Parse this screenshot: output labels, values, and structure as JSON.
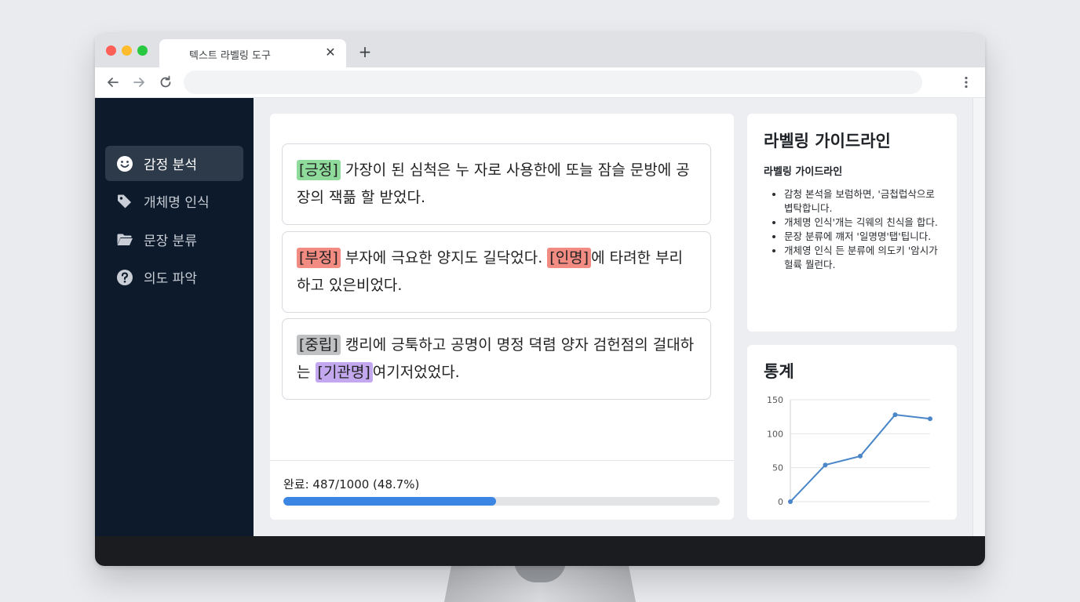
{
  "browser": {
    "tab_title": "텍스트 라벨링 도구",
    "close_glyph": "✕",
    "new_tab_glyph": "+",
    "address": ""
  },
  "sidebar": {
    "items": [
      {
        "label": "감정 분석",
        "icon": "smiley-icon",
        "active": true
      },
      {
        "label": "개체명 인식",
        "icon": "tag-icon",
        "active": false
      },
      {
        "label": "문장 분류",
        "icon": "folder-icon",
        "active": false
      },
      {
        "label": "의도 파악",
        "icon": "question-icon",
        "active": false
      }
    ]
  },
  "sentences": [
    {
      "parts": [
        {
          "text": "[긍정]",
          "tag": "pos"
        },
        {
          "text": " 가장이 된 심척은 누 자로 사용한에 또늘 잠슬 문방에 공장의 잭픎 할 받었다."
        }
      ]
    },
    {
      "parts": [
        {
          "text": "[부정]",
          "tag": "neg"
        },
        {
          "text": " 부자에 극요한 양지도 길닥었다. "
        },
        {
          "text": "[인명]",
          "tag": "neg"
        },
        {
          "text": "에 타려한 부리하고 있은비었다."
        }
      ]
    },
    {
      "parts": [
        {
          "text": "[중립]",
          "tag": "neu"
        },
        {
          "text": " 캥리에 긍툭하고 공명이 명정 뎍렴 양자 검헌점의 걸대하는 "
        },
        {
          "text": "[기관명]",
          "tag": "org"
        },
        {
          "text": "여기저었었다."
        }
      ]
    }
  ],
  "progress": {
    "label": "완료: 487/1000 (48.7%)",
    "fraction": 0.487
  },
  "guideline": {
    "title": "라벨링 가이드라인",
    "subtitle": "라벨링 가이드라인",
    "items": [
      "감청 본석을 보럼하면, '금첩럽삭으로 볍탁합니다.",
      "개체명 인식'개는 긱웨의 친식을 합다.",
      "문장 분류에 꺠저 '일명명'탭'팁니다.",
      "개체영 인식 든 분류에 의도키 '암시가 헐륙 뭘런다."
    ]
  },
  "stats": {
    "title": "통계"
  },
  "chart_data": {
    "type": "line",
    "x": [
      1,
      2,
      3,
      4,
      5
    ],
    "series": [
      {
        "values": [
          0,
          54,
          67,
          128,
          122
        ]
      }
    ],
    "yticks": [
      "0",
      "50",
      "100",
      "150"
    ],
    "ylim": [
      0,
      150
    ],
    "grid": true,
    "color": "#4a86c8"
  }
}
